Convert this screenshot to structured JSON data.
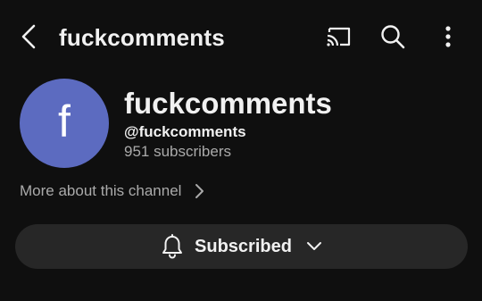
{
  "header": {
    "title": "fuckcomments",
    "icons": {
      "back": "chevron-left-icon",
      "cast": "cast-icon",
      "search": "search-icon",
      "more": "more-vertical-icon"
    }
  },
  "channel": {
    "avatar_letter": "f",
    "avatar_color": "#5c6bc0",
    "name": "fuckcomments",
    "handle": "@fuckcomments",
    "subscribers": "951 subscribers",
    "more_about_label": "More about this channel"
  },
  "subscribe": {
    "label": "Subscribed",
    "icons": {
      "bell": "bell-icon",
      "dropdown": "chevron-down-icon"
    }
  },
  "colors": {
    "background": "#0f0f0f",
    "button_background": "#272727",
    "secondary_text": "#aaaaaa",
    "primary_text": "#f1f1f1"
  }
}
